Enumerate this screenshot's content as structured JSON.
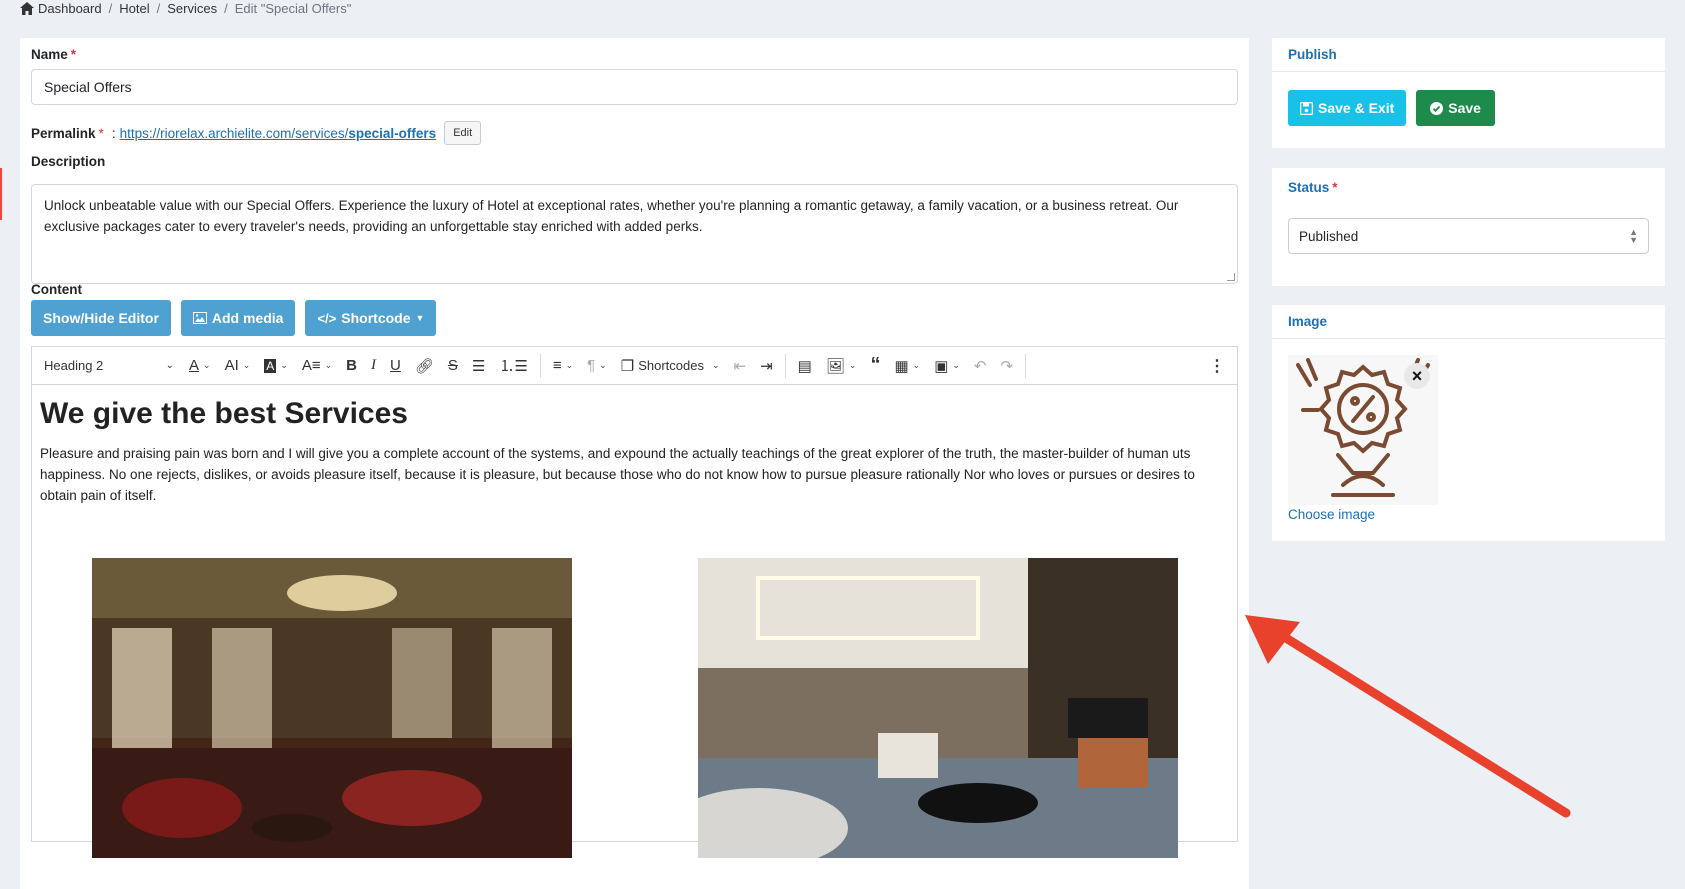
{
  "breadcrumb": {
    "home": "Dashboard",
    "items": [
      "Hotel",
      "Services"
    ],
    "current": "Edit \"Special Offers\""
  },
  "form": {
    "name_label": "Name",
    "name_value": "Special Offers",
    "permalink_label": "Permalink",
    "permalink_base": "https://riorelax.archielite.com/services/",
    "permalink_slug": "special-offers",
    "permalink_edit": "Edit",
    "description_label": "Description",
    "description_value": "Unlock unbeatable value with our Special Offers. Experience the luxury of Hotel at exceptional rates, whether you're planning a romantic getaway, a family vacation, or a business retreat. Our exclusive packages cater to every traveler's needs, providing an unforgettable stay enriched with added perks.",
    "content_label": "Content"
  },
  "content_buttons": {
    "show_hide": "Show/Hide Editor",
    "add_media": "Add media",
    "shortcode": "Shortcode"
  },
  "toolbar": {
    "heading": "Heading 2",
    "shortcodes": "Shortcodes"
  },
  "editor": {
    "heading": "We give the best Services",
    "paragraph": "Pleasure and praising pain was born and I will give you a complete account of the systems, and expound the actually teachings of the great explorer of the truth, the master-builder of human uts happiness. No one rejects, dislikes, or avoids pleasure itself, because it is pleasure, but because those who do not know how to pursue pleasure rationally Nor who loves or pursues or desires to obtain pain of itself."
  },
  "publish": {
    "title": "Publish",
    "save_exit": "Save & Exit",
    "save": "Save"
  },
  "status": {
    "title": "Status",
    "value": "Published"
  },
  "image": {
    "title": "Image",
    "choose": "Choose image"
  },
  "colors": {
    "accent": "#1f6fb2",
    "button_blue": "#4fa1d1",
    "button_cyan": "#17c1e8",
    "button_green": "#1e8a4b",
    "arrow": "#e8412c"
  }
}
